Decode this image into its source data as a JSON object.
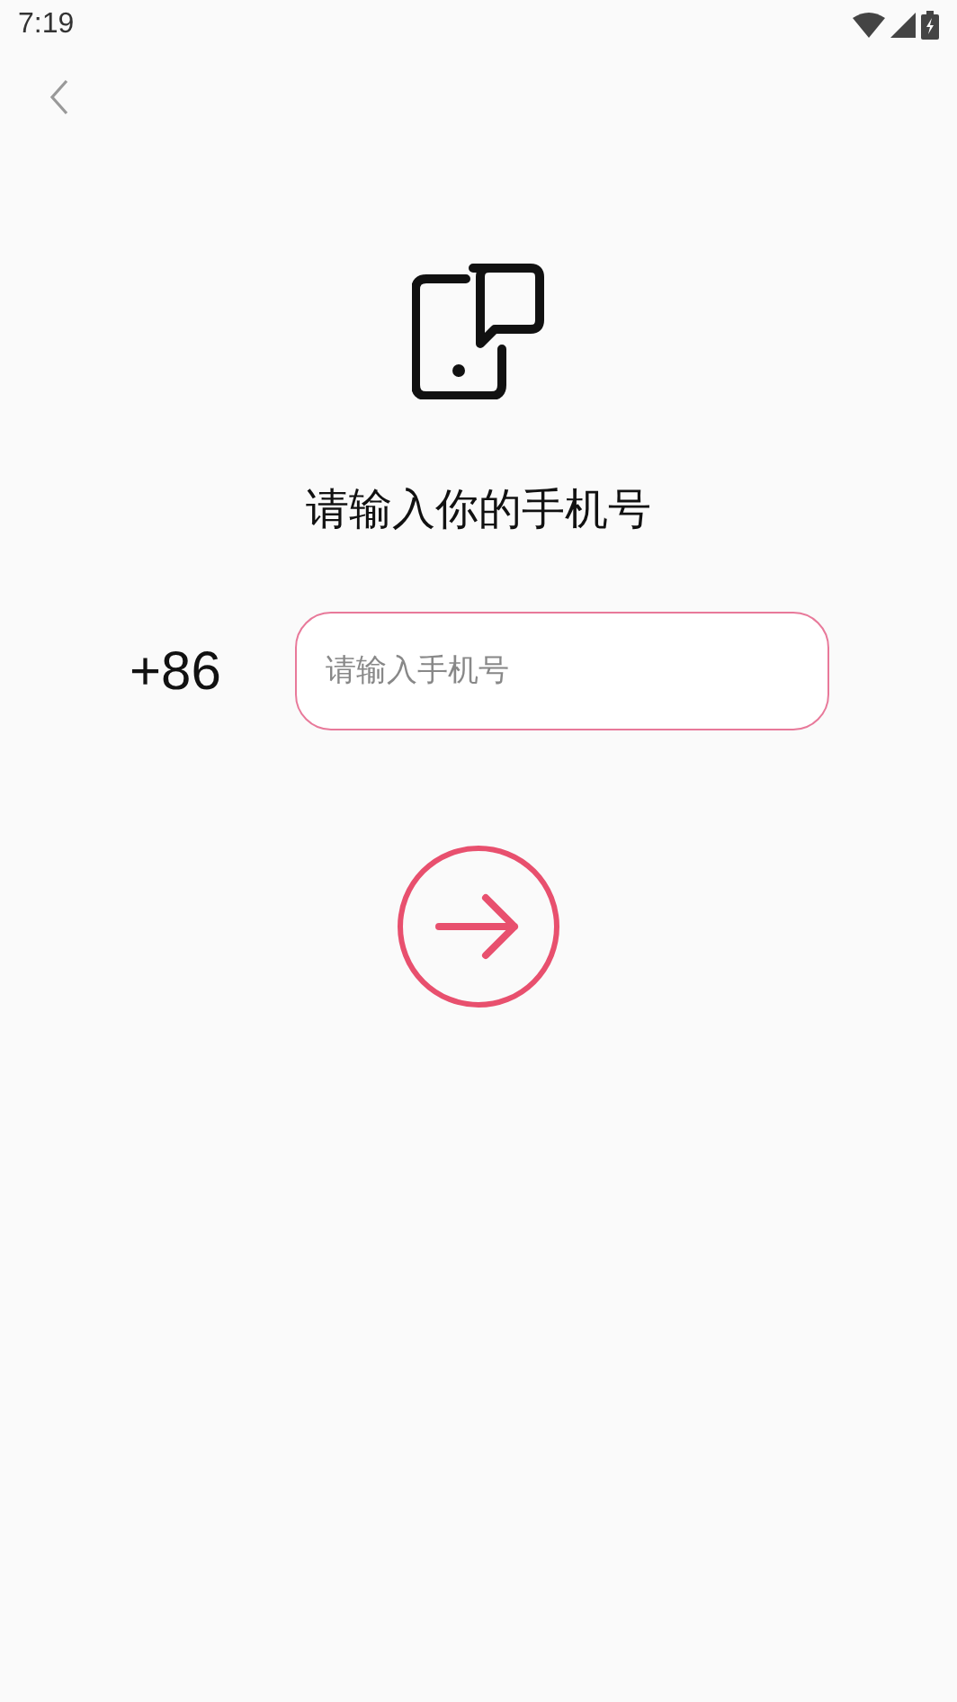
{
  "status_bar": {
    "time": "7:19"
  },
  "title": "请输入你的手机号",
  "phone": {
    "country_code": "+86",
    "placeholder": "请输入手机号"
  }
}
